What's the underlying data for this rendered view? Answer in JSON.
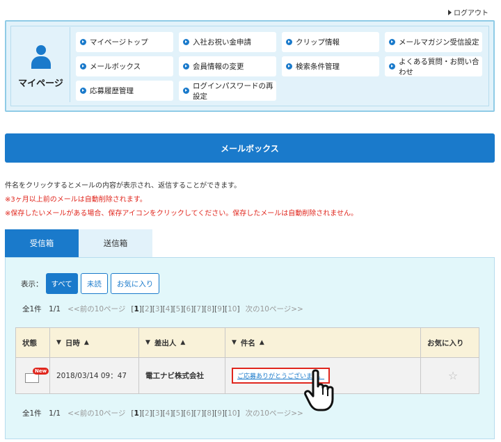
{
  "header": {
    "logout_label": "ログアウト"
  },
  "mypage": {
    "label": "マイページ",
    "menu": [
      "マイページトップ",
      "入社お祝い金申請",
      "クリップ情報",
      "メールマガジン受信設定",
      "メールボックス",
      "会員情報の変更",
      "検索条件管理",
      "よくある質問・お問い合わせ",
      "応募履歴管理",
      "ログインパスワードの再設定"
    ]
  },
  "page_title": "メールボックス",
  "notes": {
    "line1": "件名をクリックするとメールの内容が表示され、返信することができます。",
    "line2": "※3ヶ月以上前のメールは自動削除されます。",
    "line3": "※保存したいメールがある場合、保存アイコンをクリックしてください。保存したメールは自動削除されません。"
  },
  "tabs": {
    "inbox": "受信箱",
    "sent": "送信箱"
  },
  "filter": {
    "label": "表示：",
    "all": "すべて",
    "unread": "未読",
    "favorites": "お気に入り"
  },
  "pager": {
    "count": "全1件　1/1",
    "prev": "<<前の10ページ",
    "pages": [
      "[",
      "1",
      "][",
      "2",
      "][",
      "3",
      "][",
      "4",
      "][",
      "5",
      "][",
      "6",
      "][",
      "7",
      "][",
      "8",
      "][",
      "9",
      "][",
      "10",
      "]"
    ],
    "next": "次の10ページ>>"
  },
  "table": {
    "headers": {
      "status": "状態",
      "date": "日時",
      "sender": "差出人",
      "subject": "件名",
      "favorite": "お気に入り"
    },
    "sort_desc": "▼",
    "sort_asc": "▲",
    "rows": [
      {
        "badge": "New",
        "date": "2018/03/14 09：47",
        "sender": "電工ナビ株式会社",
        "subject": "ご応募ありがとうございます。",
        "star": "☆"
      }
    ]
  }
}
